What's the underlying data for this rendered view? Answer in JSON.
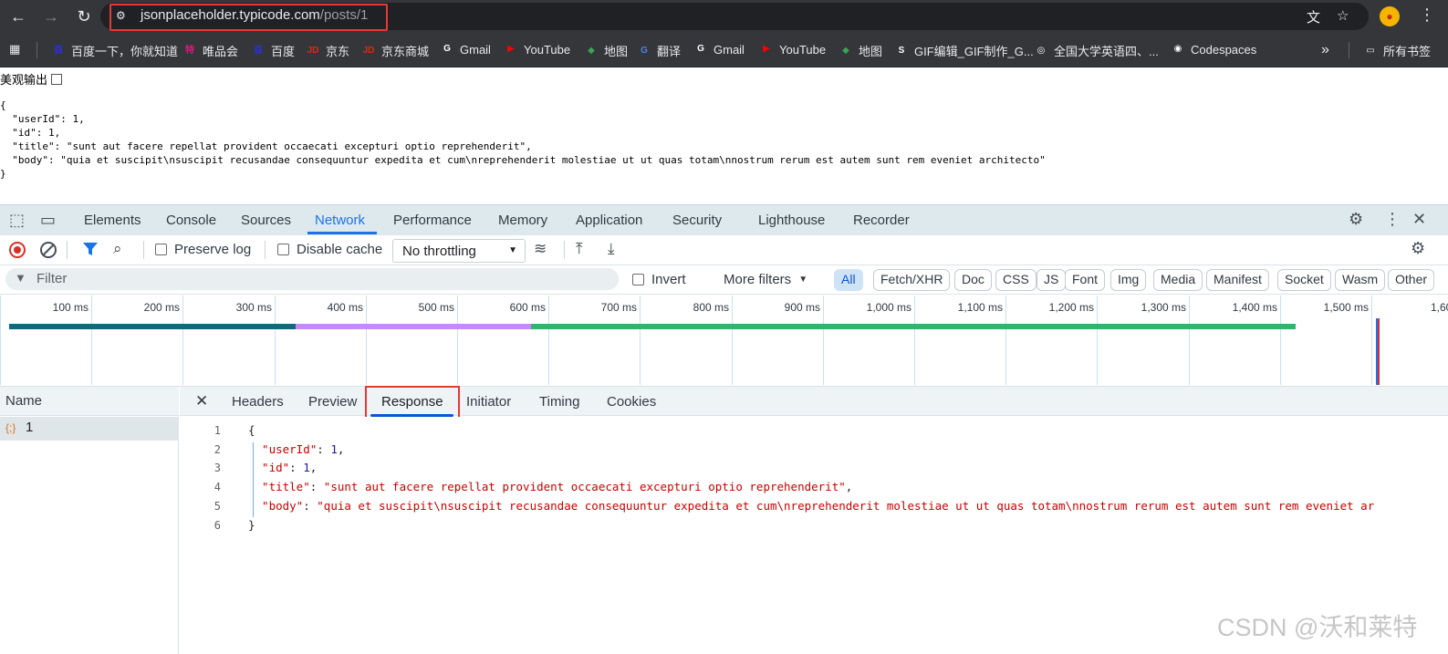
{
  "browser": {
    "url_host": "jsonplaceholder.typicode.com",
    "url_path": "/posts/1",
    "icons": [
      "back-icon",
      "forward-icon",
      "reload-icon",
      "site-settings-icon",
      "translate-icon",
      "star-icon",
      "menu-icon"
    ]
  },
  "bookmarks": {
    "items": [
      {
        "label": "百度一下，你就知道",
        "icon": "百",
        "color": "#2932e1"
      },
      {
        "label": "唯品会",
        "icon": "特",
        "color": "#e0187a"
      },
      {
        "label": "百度",
        "icon": "百",
        "color": "#2932e1"
      },
      {
        "label": "京东",
        "icon": "JD",
        "color": "#e1251b"
      },
      {
        "label": "京东商城",
        "icon": "JD",
        "color": "#e1251b"
      },
      {
        "label": "Gmail",
        "icon": "G",
        "color": "#ffffff"
      },
      {
        "label": "YouTube",
        "icon": "▶",
        "color": "#ff0000"
      },
      {
        "label": "地图",
        "icon": "◆",
        "color": "#34a853"
      },
      {
        "label": "翻译",
        "icon": "G",
        "color": "#4285f4"
      },
      {
        "label": "Gmail",
        "icon": "G",
        "color": "#ffffff"
      },
      {
        "label": "YouTube",
        "icon": "▶",
        "color": "#ff0000"
      },
      {
        "label": "地图",
        "icon": "◆",
        "color": "#34a853"
      },
      {
        "label": "GIF编辑_GIF制作_G...",
        "icon": "S",
        "color": "#ffffff"
      },
      {
        "label": "全国大学英语四、...",
        "icon": "◎",
        "color": "#ffffff"
      },
      {
        "label": "Codespaces",
        "icon": "◉",
        "color": "#ffffff"
      }
    ],
    "more": "»",
    "all_bookmarks": "所有书签"
  },
  "page": {
    "pretty_print_label": "美观输出",
    "raw_lines": [
      "{",
      "  \"userId\": 1,",
      "  \"id\": 1,",
      "  \"title\": \"sunt aut facere repellat provident occaecati excepturi optio reprehenderit\",",
      "  \"body\": \"quia et suscipit\\nsuscipit recusandae consequuntur expedita et cum\\nreprehenderit molestiae ut ut quas totam\\nnostrum rerum est autem sunt rem eveniet architecto\"",
      "}"
    ]
  },
  "devtools": {
    "tabs": [
      "Elements",
      "Console",
      "Sources",
      "Network",
      "Performance",
      "Memory",
      "Application",
      "Security",
      "Lighthouse",
      "Recorder"
    ],
    "active_tab": "Network",
    "toolbar": {
      "preserve_log": "Preserve log",
      "disable_cache": "Disable cache",
      "throttling": "No throttling"
    },
    "filter": {
      "placeholder": "Filter",
      "invert": "Invert",
      "more_filters": "More filters",
      "types": [
        "All",
        "Fetch/XHR",
        "Doc",
        "CSS",
        "JS",
        "Font",
        "Img",
        "Media",
        "Manifest",
        "Socket",
        "Wasm",
        "Other"
      ],
      "active_type": "All"
    },
    "timeline": {
      "ticks": [
        "100 ms",
        "200 ms",
        "300 ms",
        "400 ms",
        "500 ms",
        "600 ms",
        "700 ms",
        "800 ms",
        "900 ms",
        "1,000 ms",
        "1,100 ms",
        "1,200 ms",
        "1,300 ms",
        "1,400 ms",
        "1,500 ms",
        "1,60"
      ],
      "colors": {
        "waiting": "#11697b",
        "download": "#c58af9",
        "content": "#34b36e",
        "marker": "#d93025"
      }
    },
    "requests": {
      "header": "Name",
      "rows": [
        {
          "name": "1",
          "icon": "{;}"
        }
      ]
    },
    "detail_tabs": [
      "Headers",
      "Preview",
      "Response",
      "Initiator",
      "Timing",
      "Cookies"
    ],
    "active_detail_tab": "Response",
    "response": {
      "line_numbers": [
        "1",
        "2",
        "3",
        "4",
        "5",
        "6"
      ],
      "open_brace": "{",
      "close_brace": "}",
      "entries": [
        {
          "key": "\"userId\"",
          "value": "1",
          "type": "number",
          "comma": ","
        },
        {
          "key": "\"id\"",
          "value": "1",
          "type": "number",
          "comma": ","
        },
        {
          "key": "\"title\"",
          "value": "\"sunt aut facere repellat provident occaecati excepturi optio reprehenderit\"",
          "type": "string",
          "comma": ","
        },
        {
          "key": "\"body\"",
          "value": "\"quia et suscipit\\nsuscipit recusandae consequuntur expedita et cum\\nreprehenderit molestiae ut ut quas totam\\nnostrum rerum est autem sunt rem eveniet ar",
          "type": "string",
          "comma": ""
        }
      ]
    }
  },
  "watermark": "CSDN @沃和莱特"
}
